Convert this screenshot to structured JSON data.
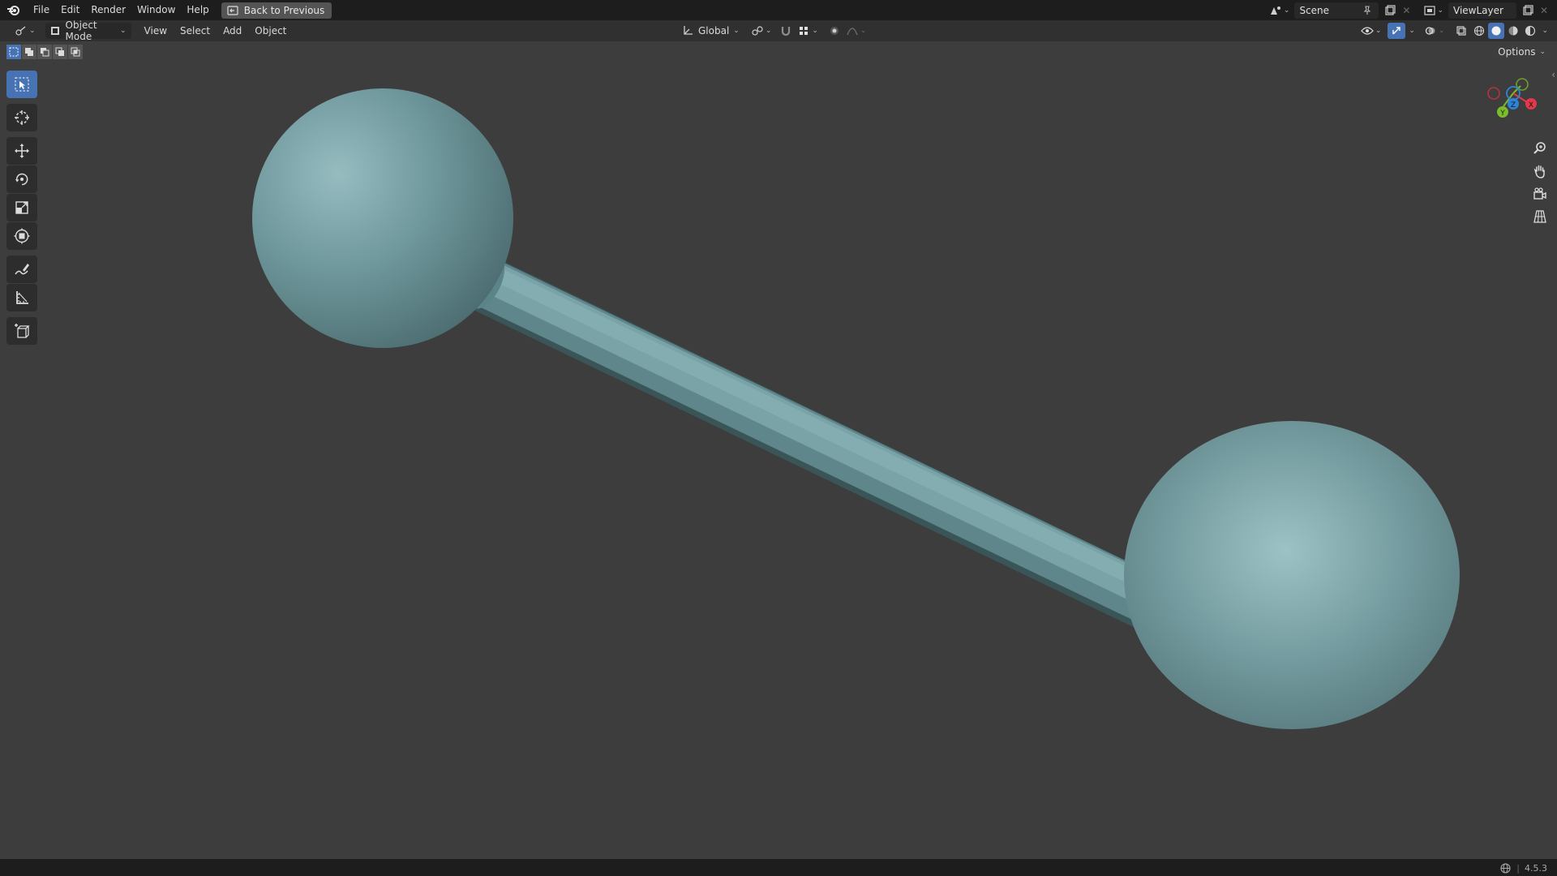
{
  "menu": {
    "items": [
      "File",
      "Edit",
      "Render",
      "Window",
      "Help"
    ],
    "back_label": "Back to Previous"
  },
  "scene": {
    "name": "Scene"
  },
  "view_layer": {
    "name": "ViewLayer"
  },
  "viewport_header": {
    "mode": "Object Mode",
    "menus": [
      "View",
      "Select",
      "Add",
      "Object"
    ],
    "orientation": "Global"
  },
  "viewport": {
    "options_label": "Options",
    "object_color": "#6e9aa0",
    "background_color": "#3d3d3d"
  },
  "gizmo": {
    "x_label": "X",
    "y_label": "Y",
    "z_label": "Z",
    "x_color": "#e0394b",
    "y_color": "#7bbb2e",
    "z_color": "#2f83d6"
  },
  "status": {
    "version": "4.5.3"
  }
}
